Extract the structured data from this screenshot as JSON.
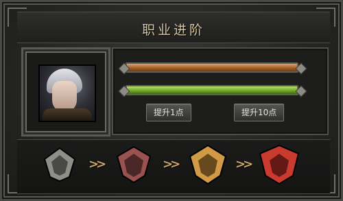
{
  "panel": {
    "title": "职业进阶"
  },
  "progress": {
    "bars": [
      {
        "name": "orange-progress",
        "fraction": 1.0
      },
      {
        "name": "green-progress",
        "fraction": 1.0
      }
    ]
  },
  "buttons": {
    "upgrade_1": "提升1点",
    "upgrade_10": "提升10点"
  },
  "ranks": {
    "icons": [
      "rank-iron-icon",
      "rank-bronze-icon",
      "rank-gold-icon",
      "rank-crimson-icon"
    ],
    "colors": [
      "#8f8f89",
      "#9a5250",
      "#d19a45",
      "#c93a2f"
    ]
  },
  "arrows": ">>"
}
